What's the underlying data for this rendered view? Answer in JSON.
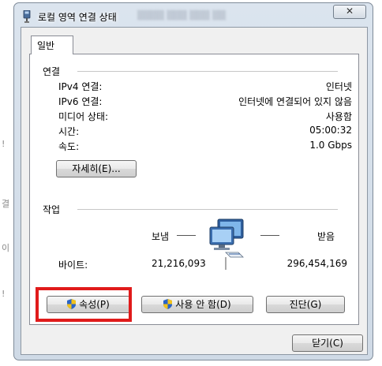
{
  "background_fragments": [
    "!",
    "결",
    "이",
    "!"
  ],
  "window": {
    "title": "로컬 영역 연결 상태",
    "close_glyph": "✕"
  },
  "tab": {
    "label": "일반"
  },
  "connection": {
    "section_label": "연결",
    "rows": [
      {
        "label": "IPv4 연결:",
        "value": "인터넷"
      },
      {
        "label": "IPv6 연결:",
        "value": "인터넷에 연결되어 있지 않음"
      },
      {
        "label": "미디어 상태:",
        "value": "사용함"
      },
      {
        "label": "시간:",
        "value": "05:00:32"
      },
      {
        "label": "속도:",
        "value": "1.0 Gbps"
      }
    ],
    "details_button": "자세히(E)..."
  },
  "activity": {
    "section_label": "작업",
    "sent_label": "보냄",
    "received_label": "받음",
    "bytes_label": "바이트:",
    "bytes_sent": "21,216,093",
    "bytes_received": "296,454,169",
    "network_icon": "network-computers-icon"
  },
  "buttons": {
    "properties": "속성(P)",
    "disable": "사용 안 함(D)",
    "diagnose": "진단(G)",
    "close": "닫기(C)"
  },
  "colors": {
    "highlight": "#e01b1b",
    "shield_blue": "#2a64c8",
    "shield_yellow": "#f2c21b"
  }
}
